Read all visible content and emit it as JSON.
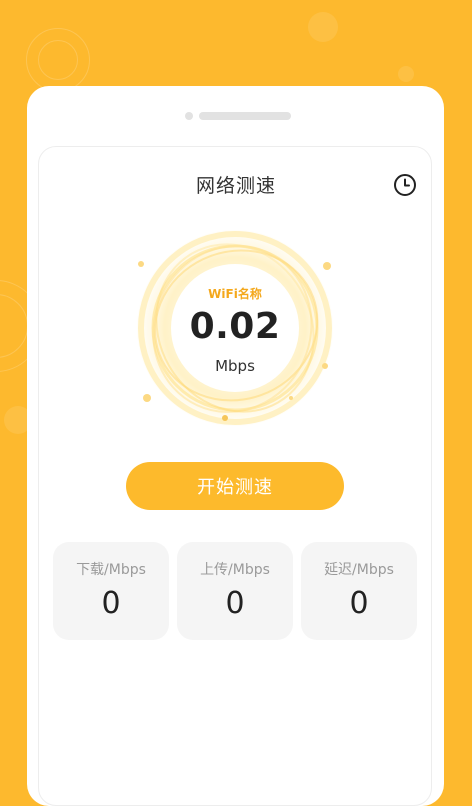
{
  "header": {
    "title": "网络测速"
  },
  "icons": {
    "history": "history-clock-icon"
  },
  "gauge": {
    "wifi_name": "WiFi名称",
    "speed_value": "0.02",
    "speed_unit": "Mbps"
  },
  "start_button": {
    "label": "开始测速"
  },
  "stats": [
    {
      "label": "下载/Mbps",
      "value": "0"
    },
    {
      "label": "上传/Mbps",
      "value": "0"
    },
    {
      "label": "延迟/Mbps",
      "value": "0"
    }
  ],
  "colors": {
    "background": "#FDB92E",
    "accent": "#FDBA2C",
    "wifi_label": "#F4A81C",
    "card": "#FFFFFF",
    "stat_box": "#F5F5F5"
  }
}
